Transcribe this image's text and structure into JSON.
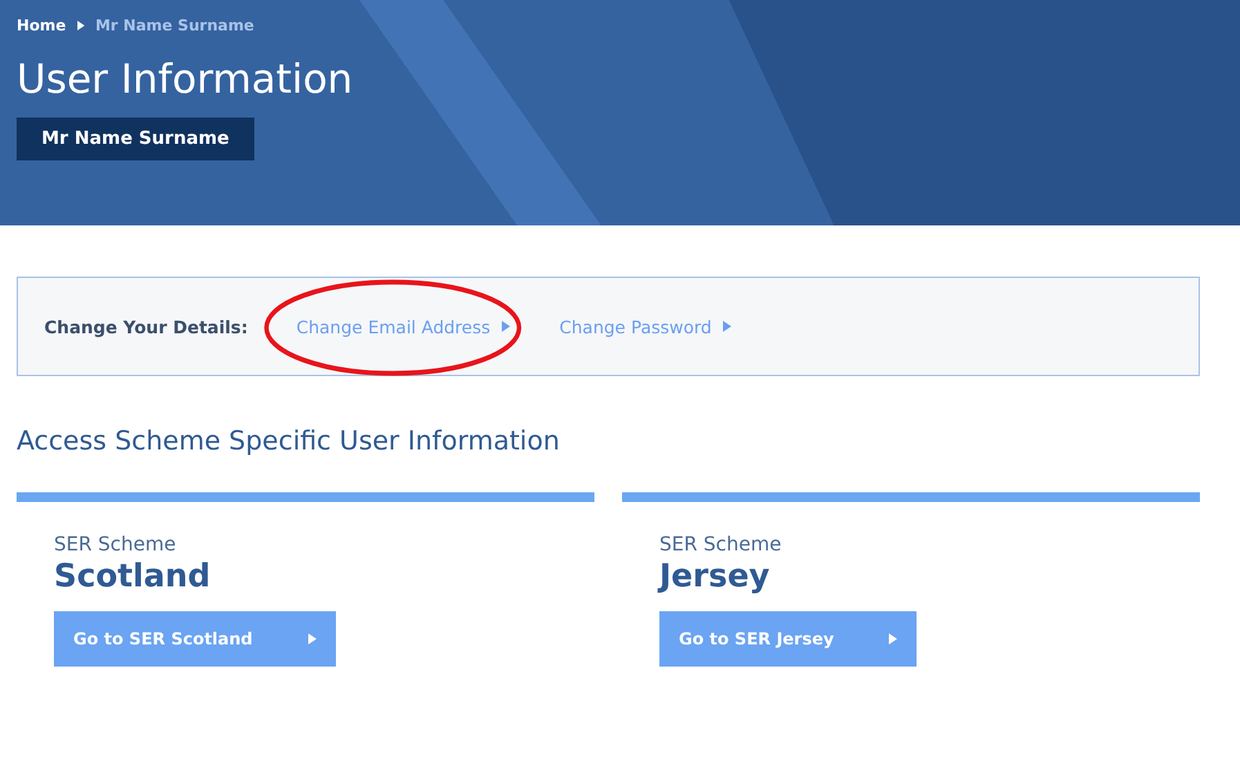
{
  "breadcrumb": [
    {
      "label": "Home",
      "current": false
    },
    {
      "label": "Mr Name Surname",
      "current": true
    }
  ],
  "title": "User Information",
  "user_badge": "Mr Name Surname",
  "details": {
    "label": "Change Your Details:",
    "links": [
      {
        "label": "Change Email Address",
        "highlighted": true
      },
      {
        "label": "Change Password",
        "highlighted": false
      }
    ]
  },
  "section_heading": "Access Scheme Specific User Information",
  "schemes": [
    {
      "kicker": "SER Scheme",
      "name": "Scotland",
      "button": "Go to SER Scotland"
    },
    {
      "kicker": "SER Scheme",
      "name": "Jersey",
      "button": "Go to SER Jersey"
    }
  ]
}
